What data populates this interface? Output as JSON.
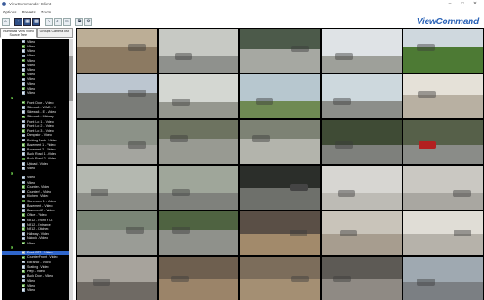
{
  "window": {
    "title": "ViewCommander Client",
    "minimize": "–",
    "maximize": "□",
    "close": "✕"
  },
  "menu": [
    "Options",
    "Presets",
    "Zoom"
  ],
  "brand": "ViewCommand",
  "sidebar": {
    "tabs": [
      {
        "label": "Thumbnail View Video Source Tree",
        "active": true
      },
      {
        "label": "Groups Camera List",
        "active": false
      }
    ],
    "tree": [
      {
        "kind": "cam",
        "label": "Video"
      },
      {
        "kind": "cam",
        "label": "Video"
      },
      {
        "kind": "cam",
        "label": "Video"
      },
      {
        "kind": "cam",
        "label": "Video"
      },
      {
        "kind": "cam",
        "label": "Video"
      },
      {
        "kind": "cam",
        "label": "Video"
      },
      {
        "kind": "cam",
        "label": "Video"
      },
      {
        "kind": "cam",
        "label": "Video"
      },
      {
        "kind": "cam",
        "label": "Video"
      },
      {
        "kind": "cam",
        "label": "Video"
      },
      {
        "kind": "cam",
        "label": "Video"
      },
      {
        "kind": "cam",
        "label": "Video"
      },
      {
        "kind": "group",
        "label": ""
      },
      {
        "kind": "cam",
        "label": "Front Door - Video"
      },
      {
        "kind": "cam",
        "label": "Sidewalk - WMD - V"
      },
      {
        "kind": "cam",
        "label": "Sidewalk - E - Video"
      },
      {
        "kind": "cam",
        "label": "Sidewalk - Midway"
      },
      {
        "kind": "cam",
        "label": "Front Lot 1 - Video"
      },
      {
        "kind": "cam",
        "label": "Front Lot 2 - Video"
      },
      {
        "kind": "cam",
        "label": "Front Lot 3 - Video"
      },
      {
        "kind": "cam",
        "label": "Dumpster - Video"
      },
      {
        "kind": "cam",
        "label": "Parking Back - Video"
      },
      {
        "kind": "cam",
        "label": "Basement 1 - Video"
      },
      {
        "kind": "cam",
        "label": "Basement 2 - Video"
      },
      {
        "kind": "cam",
        "label": "Back Road 1 - Video"
      },
      {
        "kind": "cam",
        "label": "Back Road 2 - Video"
      },
      {
        "kind": "cam",
        "label": "Upload - Video"
      },
      {
        "kind": "cam",
        "label": "Video"
      },
      {
        "kind": "group",
        "label": ""
      },
      {
        "kind": "cam",
        "label": "Video"
      },
      {
        "kind": "cam",
        "label": "Video"
      },
      {
        "kind": "cam",
        "label": "Counter - Video"
      },
      {
        "kind": "cam",
        "label": "Counter2 - Video"
      },
      {
        "kind": "cam",
        "label": "Kitchen - Video"
      },
      {
        "kind": "cam",
        "label": "Storeroom 1 - Video"
      },
      {
        "kind": "cam",
        "label": "Basement - Video"
      },
      {
        "kind": "cam",
        "label": "Basement2 - Video"
      },
      {
        "kind": "cam",
        "label": "Office - Video"
      },
      {
        "kind": "cam",
        "label": "NR12 - Front PTZ"
      },
      {
        "kind": "cam",
        "label": "NR12 - Entrance"
      },
      {
        "kind": "cam",
        "label": "NR12 - Kitchen"
      },
      {
        "kind": "cam",
        "label": "Hallway - Video"
      },
      {
        "kind": "cam",
        "label": "Nalock - Video"
      },
      {
        "kind": "cam",
        "label": "Video"
      },
      {
        "kind": "group",
        "label": ""
      },
      {
        "kind": "cam",
        "label": "Front PTZ - Video",
        "selected": true
      },
      {
        "kind": "cam",
        "label": "Counter Front - Video"
      },
      {
        "kind": "cam",
        "label": "Entrance - Video"
      },
      {
        "kind": "cam",
        "label": "Seating - Video"
      },
      {
        "kind": "cam",
        "label": "Prep - Video"
      },
      {
        "kind": "cam",
        "label": "Back Door - Video"
      },
      {
        "kind": "cam",
        "label": "Video"
      },
      {
        "kind": "cam",
        "label": "Video"
      },
      {
        "kind": "cam",
        "label": "Video"
      }
    ]
  },
  "camera_tiles": [
    {
      "scene": "room",
      "sky": "#bcae96",
      "ground": "#8c7a62"
    },
    {
      "scene": "parking",
      "sky": "#c7c9c4",
      "ground": "#8f918d"
    },
    {
      "scene": "sidewalk",
      "sky": "#4c5a4a",
      "ground": "#a6a8a2"
    },
    {
      "scene": "parking",
      "sky": "#dfe3e6",
      "ground": "#9ea09a"
    },
    {
      "scene": "lawn",
      "sky": "#cfd8de",
      "ground": "#4d7a34"
    },
    {
      "scene": "road",
      "sky": "#bcc6d0",
      "ground": "#7a7c78"
    },
    {
      "scene": "parking",
      "sky": "#d4d7d2",
      "ground": "#95978f"
    },
    {
      "scene": "lot",
      "sky": "#b7c7cf",
      "ground": "#6f8a53"
    },
    {
      "scene": "lot",
      "sky": "#cdd8dd",
      "ground": "#8c8e8a"
    },
    {
      "scene": "interior",
      "sky": "#e5e1d8",
      "ground": "#b8b0a2"
    },
    {
      "scene": "carlot",
      "sky": "#8c9288",
      "ground": "#a4a59f"
    },
    {
      "scene": "tree",
      "sky": "#6d7360",
      "ground": "#989a92"
    },
    {
      "scene": "walk",
      "sky": "#7d8274",
      "ground": "#b3b4ac"
    },
    {
      "scene": "carlot",
      "sky": "#3f4b35",
      "ground": "#7e807c"
    },
    {
      "scene": "redcar",
      "sky": "#566049",
      "ground": "#8a8c88"
    },
    {
      "scene": "lot",
      "sky": "#b4b8b0",
      "ground": "#8d8f89"
    },
    {
      "scene": "lot",
      "sky": "#9fa69a",
      "ground": "#7f817c"
    },
    {
      "scene": "night",
      "sky": "#2b2e2a",
      "ground": "#6e706b"
    },
    {
      "scene": "kitchen",
      "sky": "#d7d6d2",
      "ground": "#bdbbb5"
    },
    {
      "scene": "kitchen",
      "sky": "#cac8c2",
      "ground": "#a9a7a1"
    },
    {
      "scene": "walk",
      "sky": "#7a8576",
      "ground": "#9a9c96"
    },
    {
      "scene": "tree",
      "sky": "#4f6341",
      "ground": "#8f918b"
    },
    {
      "scene": "store",
      "sky": "#5a4f46",
      "ground": "#a28a6b"
    },
    {
      "scene": "store",
      "sky": "#c9c4ba",
      "ground": "#a79d8f"
    },
    {
      "scene": "store",
      "sky": "#e0ddd6",
      "ground": "#b6b2aa"
    },
    {
      "scene": "office",
      "sky": "#a7a39c",
      "ground": "#6f6a64"
    },
    {
      "scene": "store",
      "sky": "#6e5f4f",
      "ground": "#9b8469"
    },
    {
      "scene": "store",
      "sky": "#7c6d5b",
      "ground": "#a48f73"
    },
    {
      "scene": "store",
      "sky": "#5d5a55",
      "ground": "#8f8a84"
    },
    {
      "scene": "office",
      "sky": "#9fa9b1",
      "ground": "#7b7f83"
    }
  ]
}
